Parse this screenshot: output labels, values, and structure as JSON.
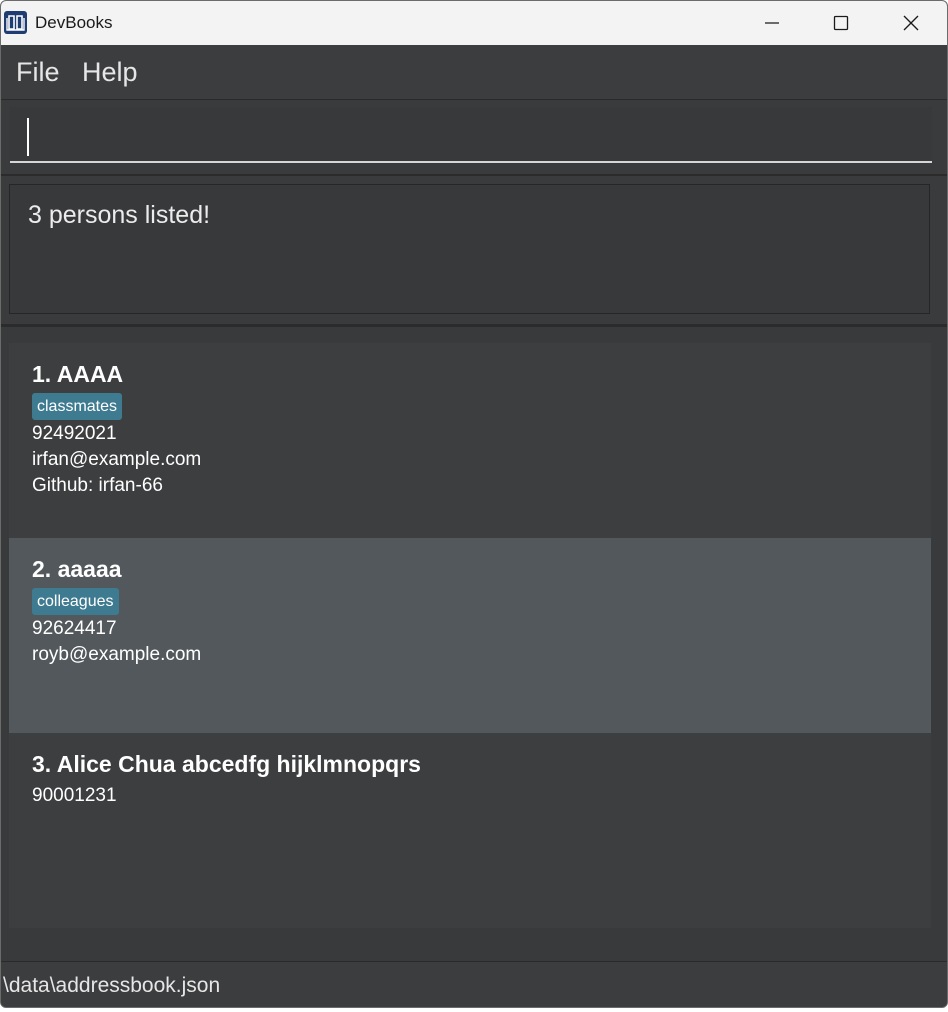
{
  "window": {
    "title": "DevBooks"
  },
  "menu": {
    "file": "File",
    "help": "Help"
  },
  "command": {
    "value": "",
    "placeholder": ""
  },
  "result": {
    "message": "3 persons listed!"
  },
  "persons": [
    {
      "name": "1. AAAA",
      "tag": "classmates",
      "phone": "92492021",
      "email": "irfan@example.com",
      "github": "Github: irfan-66"
    },
    {
      "name": "2. aaaaa",
      "tag": "colleagues",
      "phone": "92624417",
      "email": "royb@example.com"
    },
    {
      "name": "3. Alice Chua abcedfg hijklmnopqrs",
      "phone": "90001231"
    }
  ],
  "status": {
    "path": "\\data\\addressbook.json"
  },
  "colors": {
    "tag": "#3e7b91",
    "selected_card": "#52585c",
    "app_icon": "#1f3d70"
  }
}
